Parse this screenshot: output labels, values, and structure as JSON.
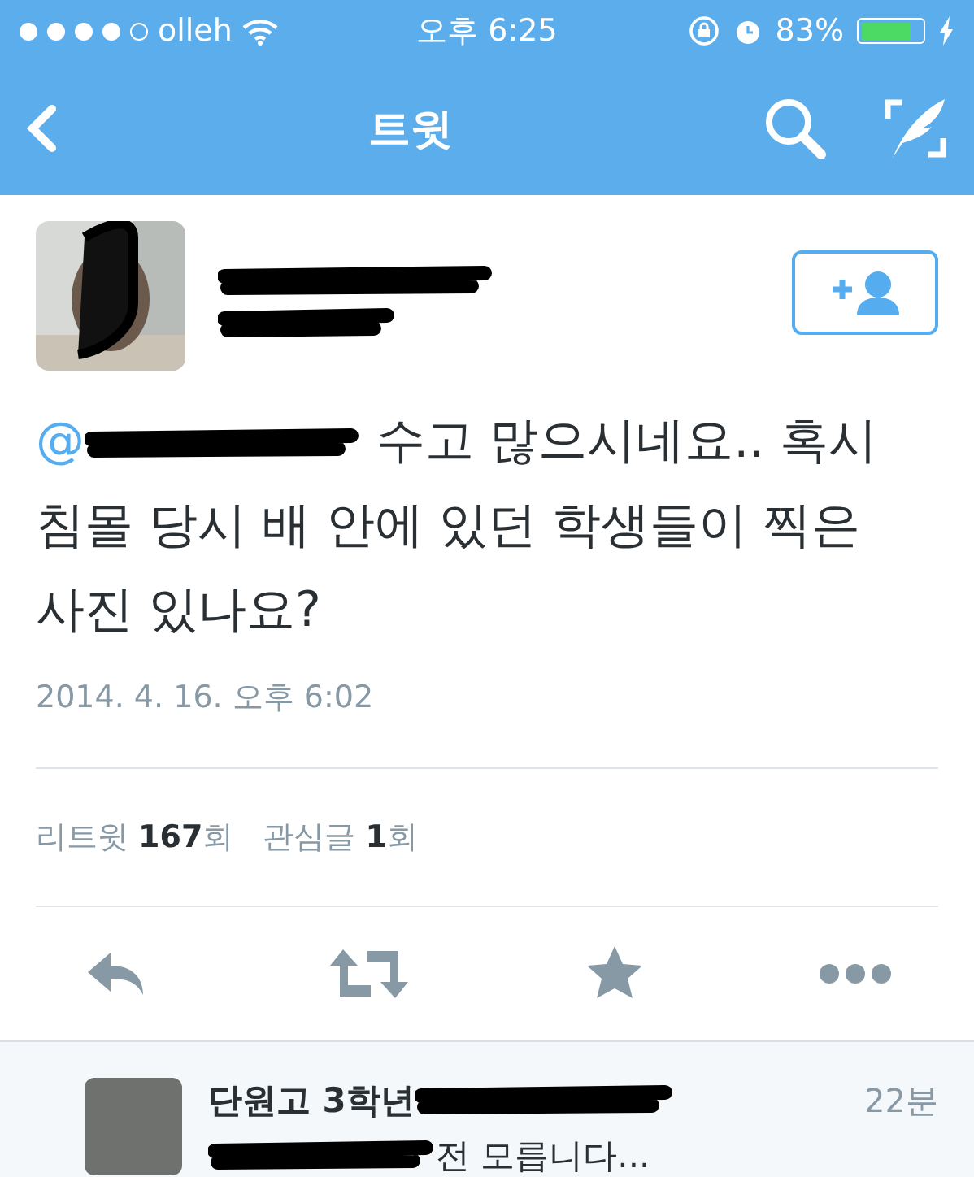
{
  "status_bar": {
    "signal_dots": [
      {
        "on": true
      },
      {
        "on": true
      },
      {
        "on": true
      },
      {
        "on": true
      },
      {
        "on": false
      }
    ],
    "carrier": "olleh",
    "time": "오후 6:25",
    "battery_text": "83%",
    "battery": {
      "level": 0.83
    }
  },
  "nav": {
    "title": "트윗"
  },
  "tweet": {
    "mention_prefix": "@",
    "text": "수고 많으시네요.. 혹시 침몰 당시 배 안에 있던 학생들이 찍은 사진 있나요?",
    "date": "2014. 4. 16. 오후 6:02"
  },
  "stats": [
    {
      "label": "리트윗",
      "count": "167",
      "unit": "회"
    },
    {
      "label": "관심글",
      "count": "1",
      "unit": "회"
    }
  ],
  "reply": {
    "name": "단원고 3학년",
    "time": "22분",
    "text": "전 모릅니다..."
  }
}
